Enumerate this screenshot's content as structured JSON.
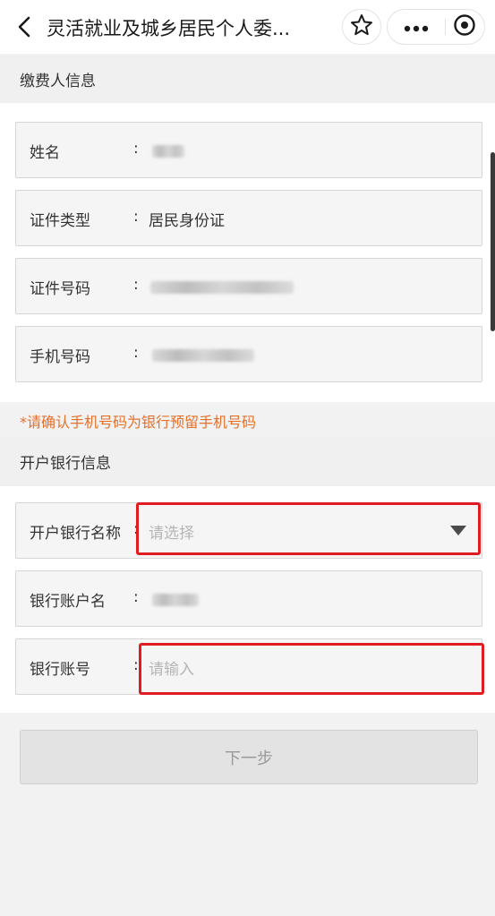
{
  "header": {
    "title": "灵活就业及城乡居民个人委...",
    "back_icon": "back-chevron-icon",
    "favorite_icon": "star-icon",
    "more_icon": "more-dots-icon",
    "close_icon": "target-close-icon"
  },
  "payer_section": {
    "title": "缴费人信息",
    "fields": [
      {
        "label": "姓名",
        "colon": ":",
        "value": ""
      },
      {
        "label": "证件类型",
        "colon": ":",
        "value": "居民身份证"
      },
      {
        "label": "证件号码",
        "colon": ":",
        "value": ""
      },
      {
        "label": "手机号码",
        "colon": ":",
        "value": ""
      }
    ]
  },
  "warning": "*请确认手机号码为银行预留手机号码",
  "bank_section": {
    "title": "开户银行信息",
    "bank_name": {
      "label": "开户银行名称",
      "colon": ":",
      "placeholder": "请选择"
    },
    "account_name": {
      "label": "银行账户名",
      "colon": ":",
      "value": ""
    },
    "account_number": {
      "label": "银行账号",
      "colon": ":",
      "placeholder": "请输入"
    }
  },
  "next_button": {
    "label": "下一步"
  },
  "colors": {
    "warning": "#e5702a",
    "highlight_box": "#e11b22",
    "button_bg": "#e3e3e3"
  }
}
